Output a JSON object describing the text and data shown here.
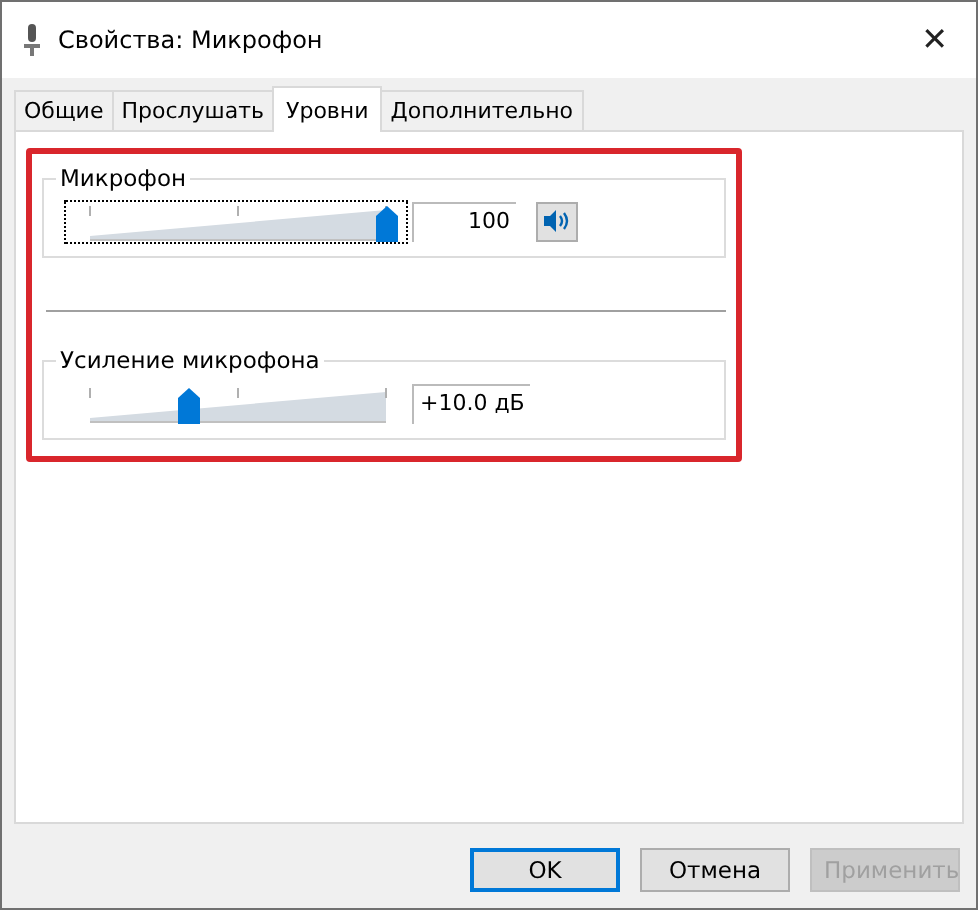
{
  "window": {
    "title": "Свойства: Микрофон",
    "close": "✕"
  },
  "tabs": [
    {
      "label": "Общие",
      "selected": false
    },
    {
      "label": "Прослушать",
      "selected": false
    },
    {
      "label": "Уровни",
      "selected": true
    },
    {
      "label": "Дополнительно",
      "selected": false
    }
  ],
  "groups": [
    {
      "title": "Микрофон",
      "level": 1.0,
      "reading": "100",
      "has_mute": true,
      "focused": true
    },
    {
      "title": "Усиление микрофона",
      "level": 0.33,
      "reading": "+10.0 дБ",
      "has_mute": false,
      "focused": false
    }
  ],
  "buttons": [
    {
      "label": "OK",
      "kind": "default"
    },
    {
      "label": "Отмена",
      "kind": "normal"
    },
    {
      "label": "Применить",
      "kind": "disabled"
    }
  ]
}
